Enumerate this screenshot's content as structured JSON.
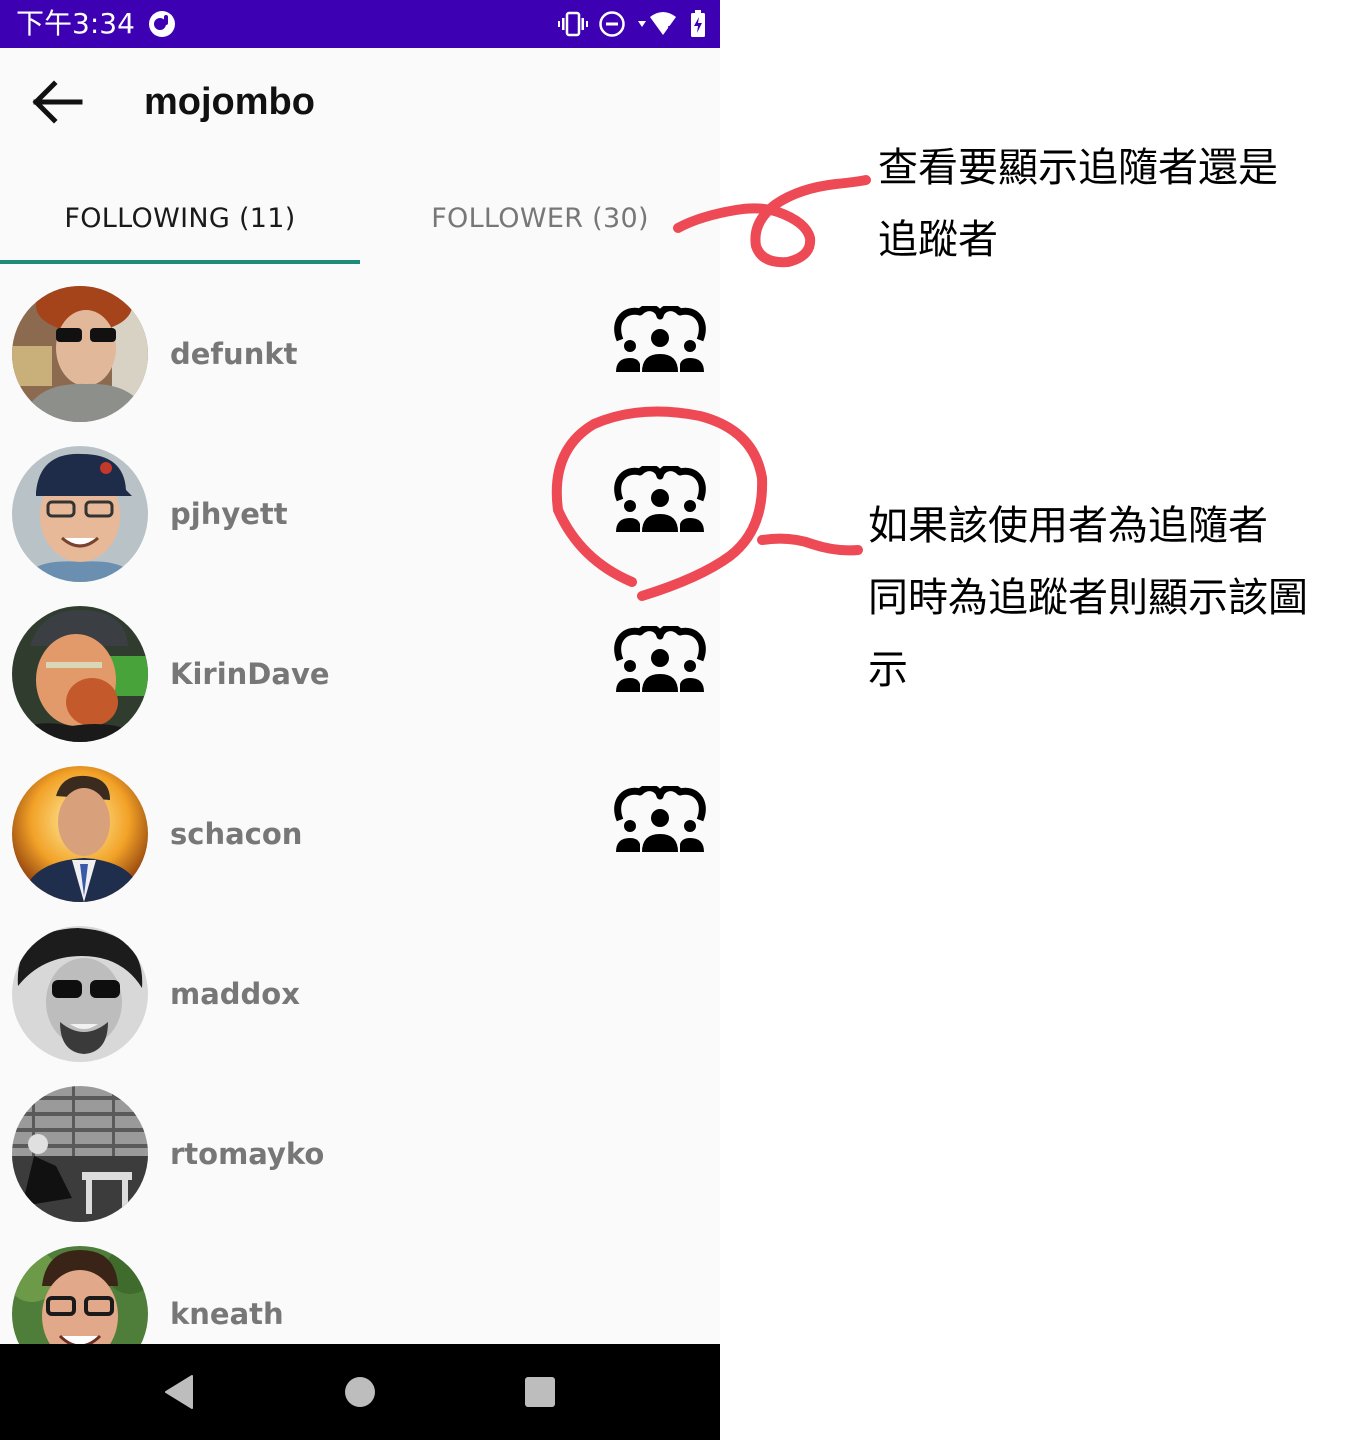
{
  "colors": {
    "status_bar": "#3e00b3",
    "accent": "#1e8a78",
    "annotation_red": "#ee4a55"
  },
  "status_bar": {
    "time": "下午3:34",
    "icons": [
      "app-notification-icon",
      "vibrate-icon",
      "do-not-disturb-icon",
      "wifi-icon",
      "battery-charging-icon"
    ]
  },
  "app_bar": {
    "back_icon": "arrow-left-icon",
    "title": "mojombo"
  },
  "tabs": [
    {
      "label": "FOLLOWING (11)",
      "selected": true
    },
    {
      "label": "FOLLOWER (30)",
      "selected": false
    }
  ],
  "users": [
    {
      "login": "defunkt",
      "mutual": true
    },
    {
      "login": "pjhyett",
      "mutual": true
    },
    {
      "login": "KirinDave",
      "mutual": true
    },
    {
      "login": "schacon",
      "mutual": true
    },
    {
      "login": "maddox",
      "mutual": false
    },
    {
      "login": "rtomayko",
      "mutual": false
    },
    {
      "login": "kneath",
      "mutual": false
    }
  ],
  "nav_bar": {
    "icons": [
      "back-triangle-icon",
      "home-circle-icon",
      "recents-square-icon"
    ]
  },
  "annotations": {
    "tab_note": [
      "查看要顯示追隨者還是",
      "追蹤者"
    ],
    "icon_note": [
      "如果該使用者為追隨者",
      "同時為追蹤者則顯示該圖",
      "示"
    ]
  }
}
